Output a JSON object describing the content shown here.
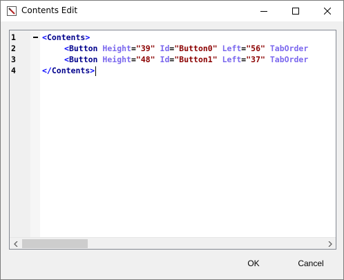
{
  "window": {
    "title": "Contents Edit"
  },
  "titlebar": {
    "minimize_icon": "minimize-icon",
    "maximize_icon": "maximize-icon",
    "close_icon": "close-icon"
  },
  "editor": {
    "lines": [
      {
        "number": "1",
        "foldable": true,
        "tokens": [
          {
            "t": "<",
            "c": "br"
          },
          {
            "t": "Contents",
            "c": "tag"
          },
          {
            "t": ">",
            "c": "br"
          }
        ]
      },
      {
        "number": "2",
        "foldable": false,
        "tokens": [
          {
            "t": "<",
            "c": "br"
          },
          {
            "t": "Button",
            "c": "tag"
          },
          {
            "t": " ",
            "c": "eq"
          },
          {
            "t": "Height",
            "c": "att"
          },
          {
            "t": "=",
            "c": "eq"
          },
          {
            "t": "\"39\"",
            "c": "val"
          },
          {
            "t": " ",
            "c": "eq"
          },
          {
            "t": "Id",
            "c": "att"
          },
          {
            "t": "=",
            "c": "eq"
          },
          {
            "t": "\"Button0\"",
            "c": "val"
          },
          {
            "t": " ",
            "c": "eq"
          },
          {
            "t": "Left",
            "c": "att"
          },
          {
            "t": "=",
            "c": "eq"
          },
          {
            "t": "\"56\"",
            "c": "val"
          },
          {
            "t": " ",
            "c": "eq"
          },
          {
            "t": "TabOrder",
            "c": "att"
          }
        ]
      },
      {
        "number": "3",
        "foldable": false,
        "tokens": [
          {
            "t": "<",
            "c": "br"
          },
          {
            "t": "Button",
            "c": "tag"
          },
          {
            "t": " ",
            "c": "eq"
          },
          {
            "t": "Height",
            "c": "att"
          },
          {
            "t": "=",
            "c": "eq"
          },
          {
            "t": "\"48\"",
            "c": "val"
          },
          {
            "t": " ",
            "c": "eq"
          },
          {
            "t": "Id",
            "c": "att"
          },
          {
            "t": "=",
            "c": "eq"
          },
          {
            "t": "\"Button1\"",
            "c": "val"
          },
          {
            "t": " ",
            "c": "eq"
          },
          {
            "t": "Left",
            "c": "att"
          },
          {
            "t": "=",
            "c": "eq"
          },
          {
            "t": "\"37\"",
            "c": "val"
          },
          {
            "t": " ",
            "c": "eq"
          },
          {
            "t": "TabOrder",
            "c": "att"
          }
        ]
      },
      {
        "number": "4",
        "foldable": false,
        "tokens": [
          {
            "t": "</",
            "c": "br"
          },
          {
            "t": "Contents",
            "c": "tag"
          },
          {
            "t": ">",
            "c": "br"
          }
        ]
      }
    ]
  },
  "buttons": {
    "ok": "OK",
    "cancel": "Cancel"
  },
  "colors": {
    "tag_bracket": "#0000ff",
    "tag_name": "#00008b",
    "attribute": "#7b68ee",
    "value": "#8b0000"
  }
}
